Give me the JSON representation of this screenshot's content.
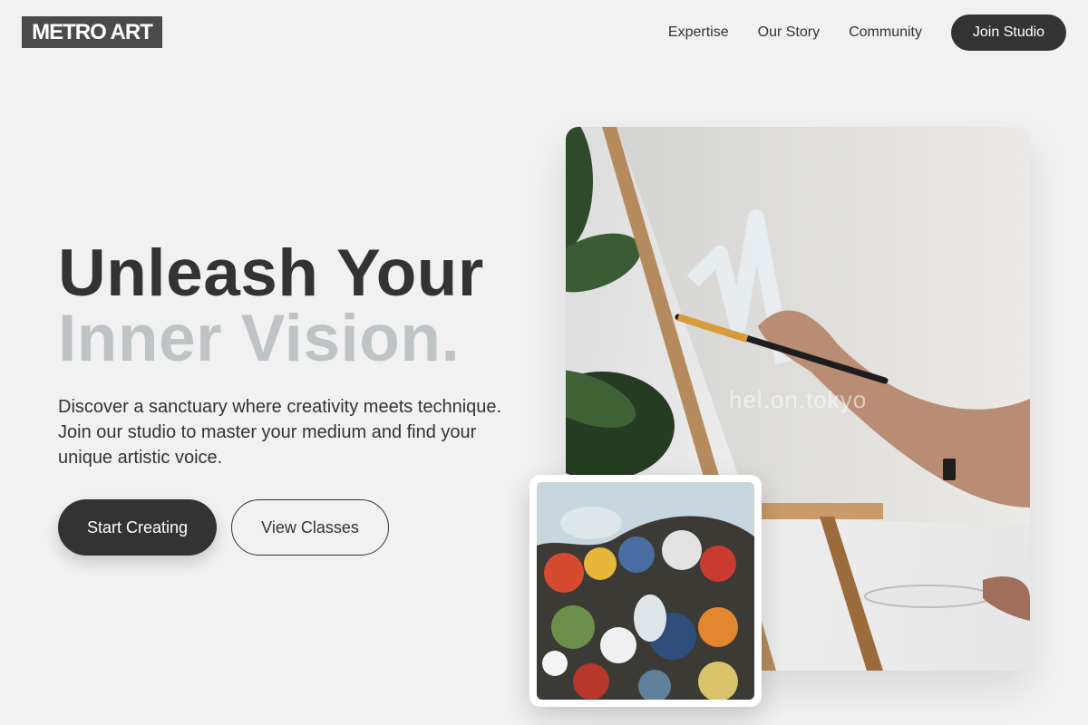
{
  "brand": {
    "logo_text": "METRO ART"
  },
  "nav": {
    "links": [
      "Expertise",
      "Our Story",
      "Community"
    ],
    "cta_label": "Join Studio"
  },
  "hero": {
    "headline_line1": "Unleash Your",
    "headline_line2": "Inner Vision.",
    "description": "Discover a sanctuary where creativity meets technique. Join our studio to master your medium and find your unique artistic voice.",
    "primary_button": "Start Creating",
    "secondary_button": "View Classes"
  },
  "images": {
    "main_photo_watermark": "hel.on.tokyo"
  },
  "colors": {
    "background": "#f1f1f1",
    "primary_dark": "#333333",
    "headline_muted": "#bec3c6",
    "logo_bg": "#4a4a4a"
  }
}
